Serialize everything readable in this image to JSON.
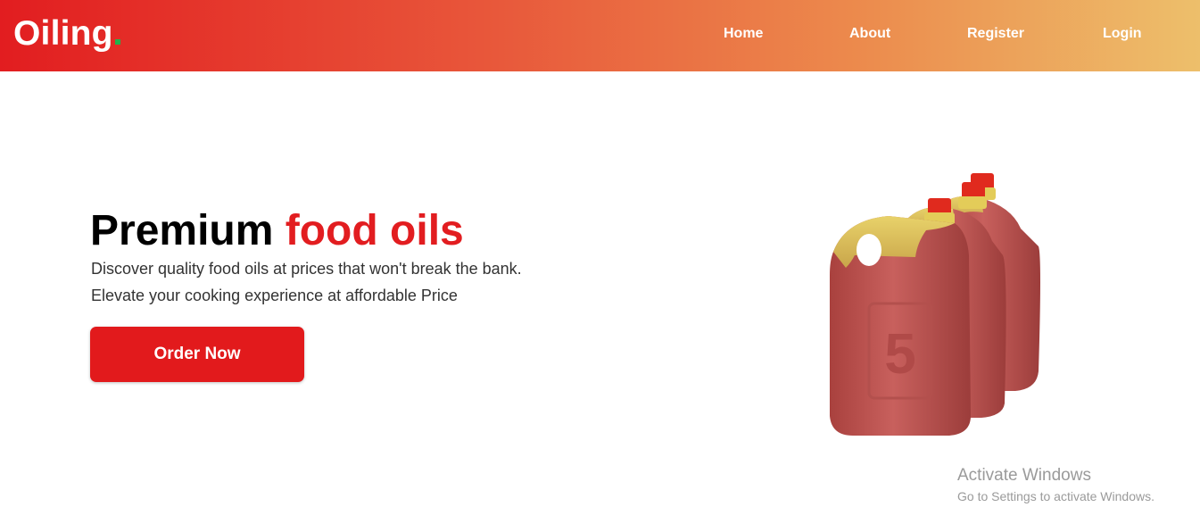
{
  "brand": {
    "name": "Oiling",
    "dot_color": "#22b24c"
  },
  "nav": {
    "items": [
      {
        "label": "Home"
      },
      {
        "label": "About"
      },
      {
        "label": "Register"
      },
      {
        "label": "Login"
      }
    ]
  },
  "hero": {
    "title_plain": "Premium",
    "title_accent": "food oils",
    "line1": "Discover quality food oils at prices that won't break the bank.",
    "line2": "Elevate your cooking experience at affordable Price",
    "cta_label": "Order Now",
    "product_image_label": "5",
    "accent_color": "#e21d20"
  },
  "watermark": {
    "title": "Activate Windows",
    "subtitle": "Go to Settings to activate Windows."
  }
}
